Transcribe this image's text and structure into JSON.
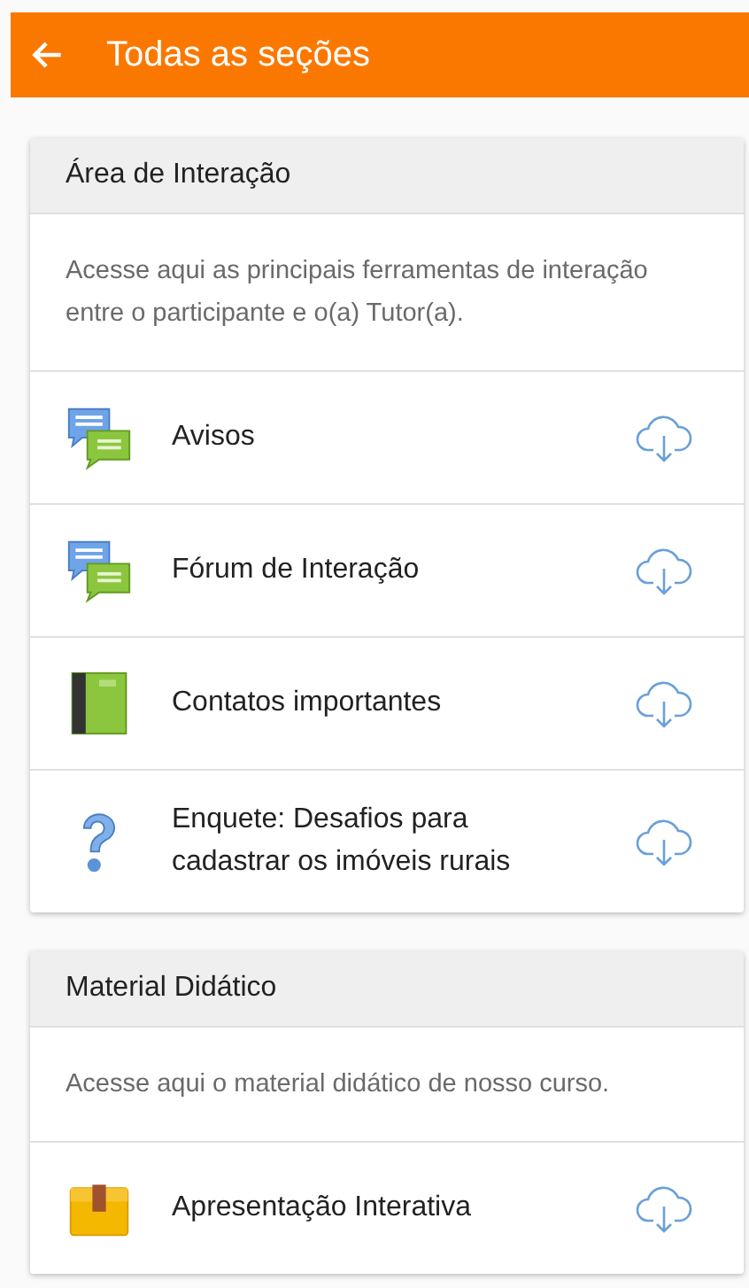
{
  "app_bar": {
    "title": "Todas as seções"
  },
  "sections": [
    {
      "title": "Área de Interação",
      "description": "Acesse aqui as principais ferramentas de interação entre o participante e o(a) Tutor(a).",
      "items": [
        {
          "label": "Avisos",
          "kind": "chat"
        },
        {
          "label": "Fórum de Interação",
          "kind": "chat"
        },
        {
          "label": "Contatos importantes",
          "kind": "book"
        },
        {
          "label": "Enquete: Desafios para cadastrar os imóveis rurais",
          "kind": "question"
        }
      ]
    },
    {
      "title": "Material Didático",
      "description": "Acesse aqui o material didático de nosso curso.",
      "items": [
        {
          "label": "Apresentação Interativa",
          "kind": "package"
        }
      ]
    }
  ]
}
